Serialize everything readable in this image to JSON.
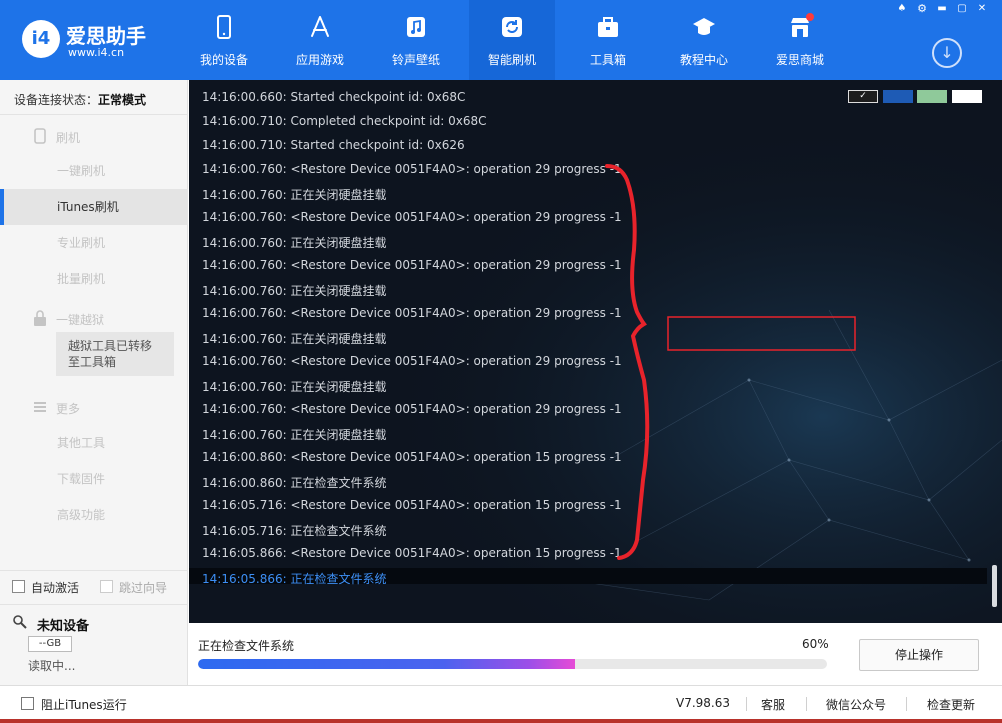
{
  "app": {
    "name": "爱思助手",
    "url": "www.i4.cn",
    "logo_text": "i4"
  },
  "nav": {
    "items": [
      {
        "label": "我的设备",
        "icon": "phone-icon"
      },
      {
        "label": "应用游戏",
        "icon": "app-store-icon"
      },
      {
        "label": "铃声壁纸",
        "icon": "music-icon"
      },
      {
        "label": "智能刷机",
        "icon": "refresh-flash-icon",
        "active": true
      },
      {
        "label": "工具箱",
        "icon": "toolbox-icon"
      },
      {
        "label": "教程中心",
        "icon": "graduation-cap-icon"
      },
      {
        "label": "爱思商城",
        "icon": "shop-icon"
      }
    ]
  },
  "sidebar": {
    "status_label": "设备连接状态：",
    "status_value": "正常模式",
    "flash_group": "刷机",
    "flash_items": [
      "一键刷机",
      "iTunes刷机",
      "专业刷机",
      "批量刷机"
    ],
    "active_item": "iTunes刷机",
    "jailbreak_group": "一键越狱",
    "jailbreak_note": "越狱工具已转移至工具箱",
    "more_group": "更多",
    "more_items": [
      "其他工具",
      "下载固件",
      "高级功能"
    ],
    "auto_activate": "自动激活",
    "skip_guide": "跳过向导",
    "device_name": "未知设备",
    "device_capacity": "--GB",
    "device_reading": "读取中..."
  },
  "log": {
    "lines": [
      "14:16:00.660: Started checkpoint id: 0x68C",
      "14:16:00.710: Completed checkpoint id: 0x68C",
      "14:16:00.710: Started checkpoint id: 0x626",
      "14:16:00.760: <Restore Device 0051F4A0>: operation 29 progress -1",
      "14:16:00.760:  正在关闭硬盘挂载",
      "14:16:00.760: <Restore Device 0051F4A0>: operation 29 progress -1",
      "14:16:00.760:  正在关闭硬盘挂载",
      "14:16:00.760: <Restore Device 0051F4A0>: operation 29 progress -1",
      "14:16:00.760:  正在关闭硬盘挂载",
      "14:16:00.760: <Restore Device 0051F4A0>: operation 29 progress -1",
      "14:16:00.760:  正在关闭硬盘挂载",
      "14:16:00.760: <Restore Device 0051F4A0>: operation 29 progress -1",
      "14:16:00.760:  正在关闭硬盘挂载",
      "14:16:00.760: <Restore Device 0051F4A0>: operation 29 progress -1",
      "14:16:00.760:  正在关闭硬盘挂载",
      "14:16:00.860: <Restore Device 0051F4A0>: operation 15 progress -1",
      "14:16:00.860:  正在检查文件系统",
      "14:16:05.716: <Restore Device 0051F4A0>: operation 15 progress -1",
      "14:16:05.716:  正在检查文件系统",
      "14:16:05.866: <Restore Device 0051F4A0>: operation 15 progress -1",
      "14:16:05.866:  正在检查文件系统"
    ],
    "swatch_colors": [
      "#1d1d1d",
      "#1e5bb5",
      "#8fc99a",
      "#ffffff"
    ]
  },
  "progress": {
    "text": "正在检查文件系统",
    "percent_label": "60%",
    "value": 0.6,
    "stop_label": "停止操作"
  },
  "footer": {
    "block_itunes": "阻止iTunes运行",
    "version": "V7.98.63",
    "service": "客服",
    "wechat": "微信公众号",
    "check_update": "检查更新"
  },
  "colors": {
    "brand": "#1e73e8",
    "log_bg": "#0d141f",
    "annotation": "#e8232b"
  }
}
